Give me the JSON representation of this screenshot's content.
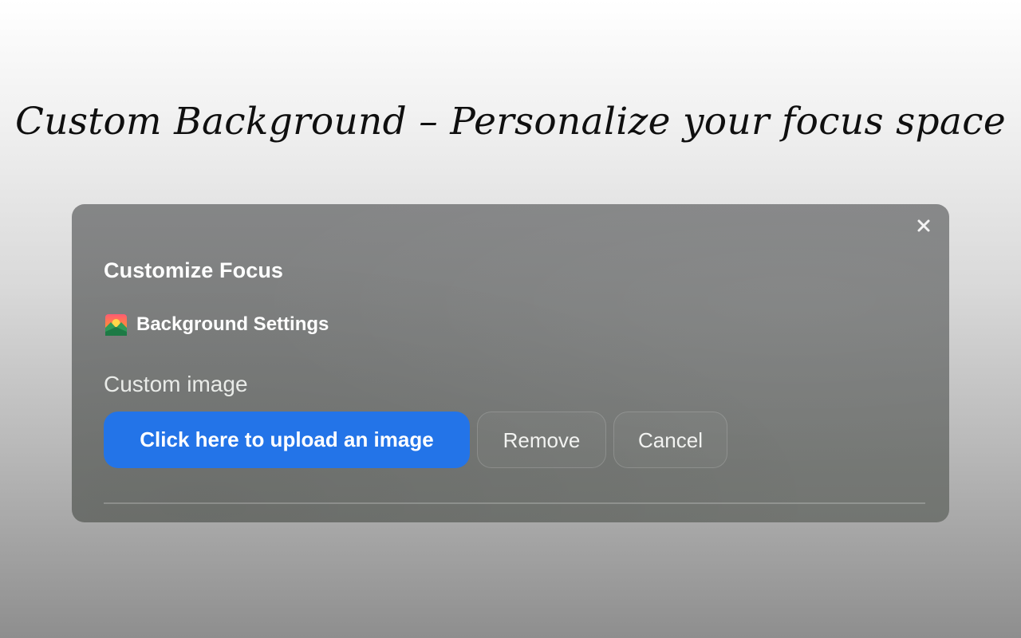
{
  "headline": "Custom Background – Personalize your focus space",
  "dialog": {
    "title": "Customize Focus",
    "close_icon": "close-icon",
    "section": {
      "icon": "landscape-image-icon",
      "title": "Background Settings"
    },
    "custom_image_label": "Custom image",
    "buttons": {
      "upload": "Click here to upload an image",
      "remove": "Remove",
      "cancel": "Cancel"
    }
  },
  "colors": {
    "primary_button": "#2374e8",
    "panel_background": "#7a7c7b",
    "text_white": "#ffffff"
  }
}
